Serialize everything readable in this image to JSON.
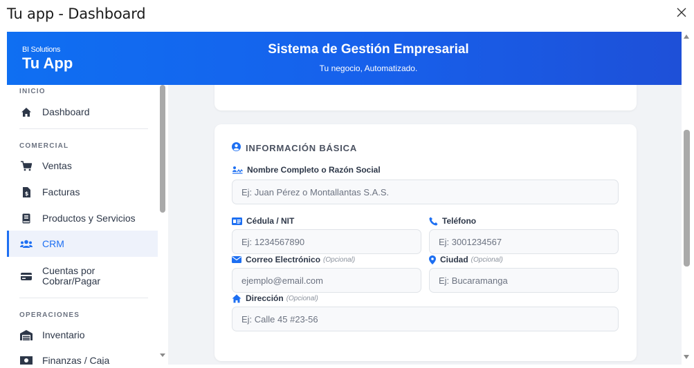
{
  "window": {
    "title": "Tu app - Dashboard"
  },
  "header": {
    "brand_small": "BI Solutions",
    "brand_big": "Tu App",
    "title": "Sistema de Gestión Empresarial",
    "subtitle": "Tu negocio, Automatizado."
  },
  "sidebar": {
    "sections": [
      "INICIO",
      "COMERCIAL",
      "OPERACIONES"
    ],
    "items": [
      {
        "label": "Dashboard",
        "icon": "home-icon"
      },
      {
        "label": "Ventas",
        "icon": "cart-icon"
      },
      {
        "label": "Facturas",
        "icon": "invoice-icon"
      },
      {
        "label": "Productos y Servicios",
        "icon": "book-icon"
      },
      {
        "label": "CRM",
        "icon": "users-icon",
        "active": true
      },
      {
        "label": "Cuentas por\nCobrar/Pagar",
        "icon": "card-icon"
      },
      {
        "label": "Inventario",
        "icon": "warehouse-icon"
      },
      {
        "label": "Finanzas / Caja",
        "icon": "cash-icon"
      }
    ]
  },
  "form": {
    "section_title": "INFORMACIÓN BÁSICA",
    "fields": {
      "name": {
        "label": "Nombre Completo o Razón Social",
        "optional": "",
        "placeholder": "Ej: Juan Pérez o Montallantas S.A.S."
      },
      "id": {
        "label": "Cédula / NIT",
        "optional": "",
        "placeholder": "Ej: 1234567890"
      },
      "phone": {
        "label": "Teléfono",
        "optional": "",
        "placeholder": "Ej: 3001234567"
      },
      "email": {
        "label": "Correo Electrónico",
        "optional": "(Opcional)",
        "placeholder": "ejemplo@email.com"
      },
      "city": {
        "label": "Ciudad",
        "optional": "(Opcional)",
        "placeholder": "Ej: Bucaramanga"
      },
      "address": {
        "label": "Dirección",
        "optional": "(Opcional)",
        "placeholder": "Ej: Calle 45 #23-56"
      }
    }
  },
  "colors": {
    "accent": "#1d6ff2",
    "header_start": "#0f6ff2",
    "header_end": "#1e50d8"
  }
}
